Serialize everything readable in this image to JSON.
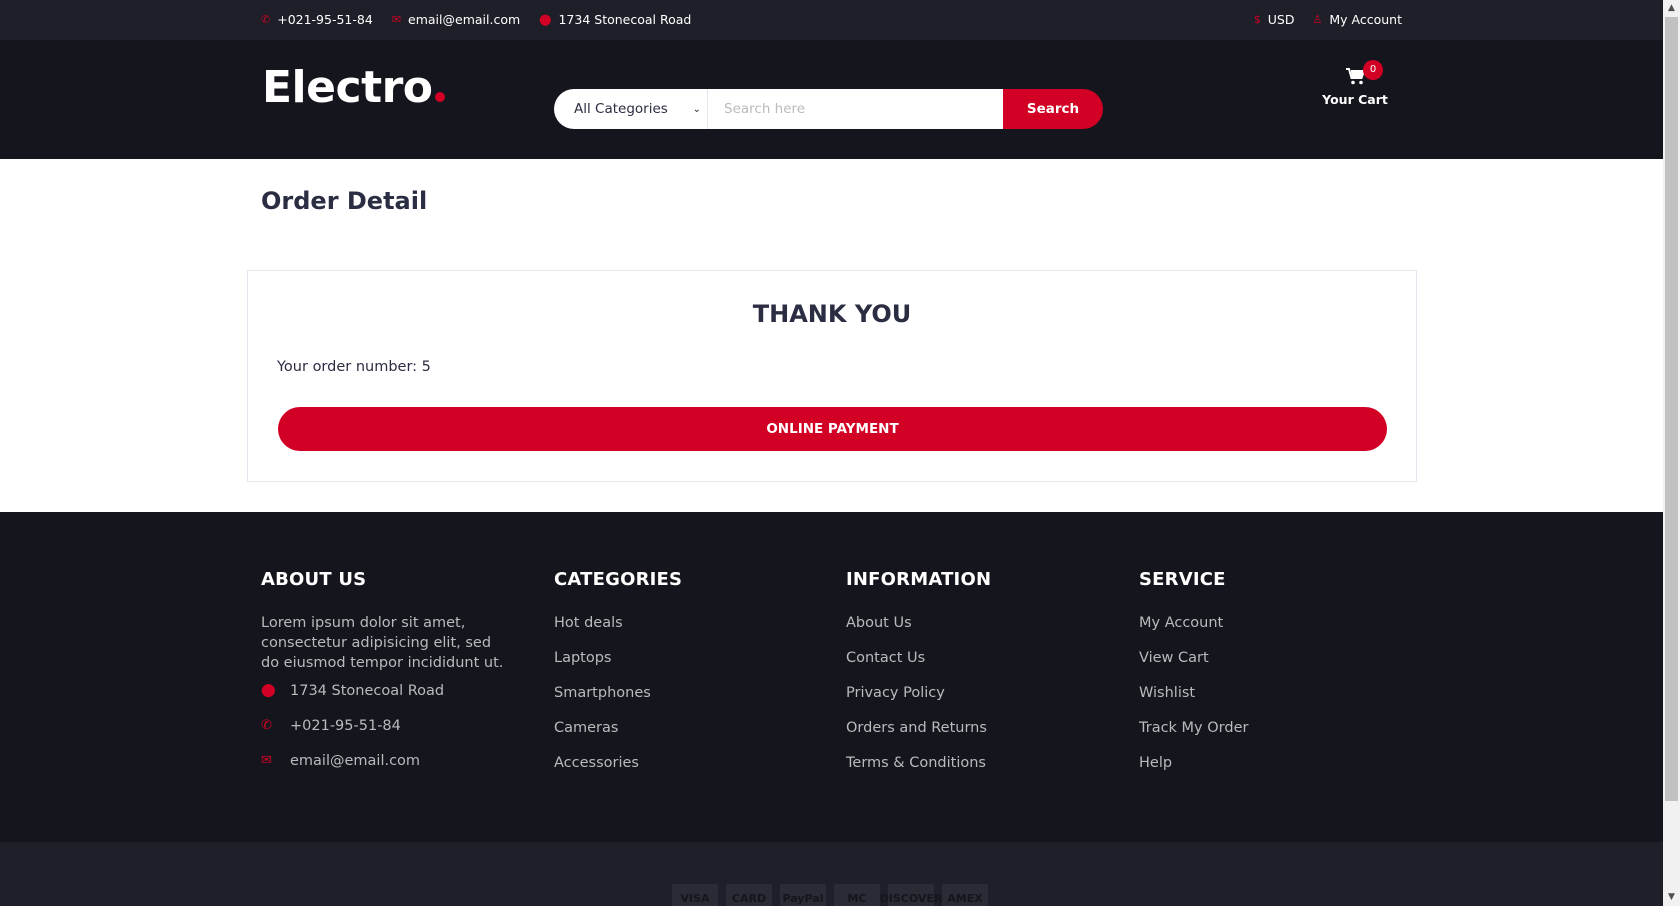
{
  "top_bar": {
    "phone": "+021-95-51-84",
    "email": "email@email.com",
    "address": "1734 Stonecoal Road",
    "currency": "USD",
    "account": "My Account"
  },
  "header": {
    "logo": "Electro",
    "category_select": "All Categories",
    "search_placeholder": "Search here",
    "search_button": "Search",
    "cart_label": "Your Cart",
    "cart_qty": "0"
  },
  "main": {
    "title": "Order Detail",
    "thank_you": "THANK YOU",
    "order_number": "Your order number: 5",
    "payment_button": "ONLINE PAYMENT"
  },
  "footer": {
    "about": {
      "heading": "ABOUT US",
      "text": "Lorem ipsum dolor sit amet, consectetur adipisicing elit, sed do eiusmod tempor incididunt ut.",
      "address": "1734 Stonecoal Road",
      "phone": "+021-95-51-84",
      "email": "email@email.com"
    },
    "categories": {
      "heading": "CATEGORIES",
      "items": [
        "Hot deals",
        "Laptops",
        "Smartphones",
        "Cameras",
        "Accessories"
      ]
    },
    "information": {
      "heading": "INFORMATION",
      "items": [
        "About Us",
        "Contact Us",
        "Privacy Policy",
        "Orders and Returns",
        "Terms & Conditions"
      ]
    },
    "service": {
      "heading": "SERVICE",
      "items": [
        "My Account",
        "View Cart",
        "Wishlist",
        "Track My Order",
        "Help"
      ]
    },
    "payment_icons": [
      "VISA",
      "CARD",
      "PayPal",
      "MC",
      "DISCOVER",
      "AMEX"
    ]
  },
  "colors": {
    "accent": "#D10024",
    "header_bg": "#15161D",
    "topbar_bg": "#1E1F29"
  }
}
